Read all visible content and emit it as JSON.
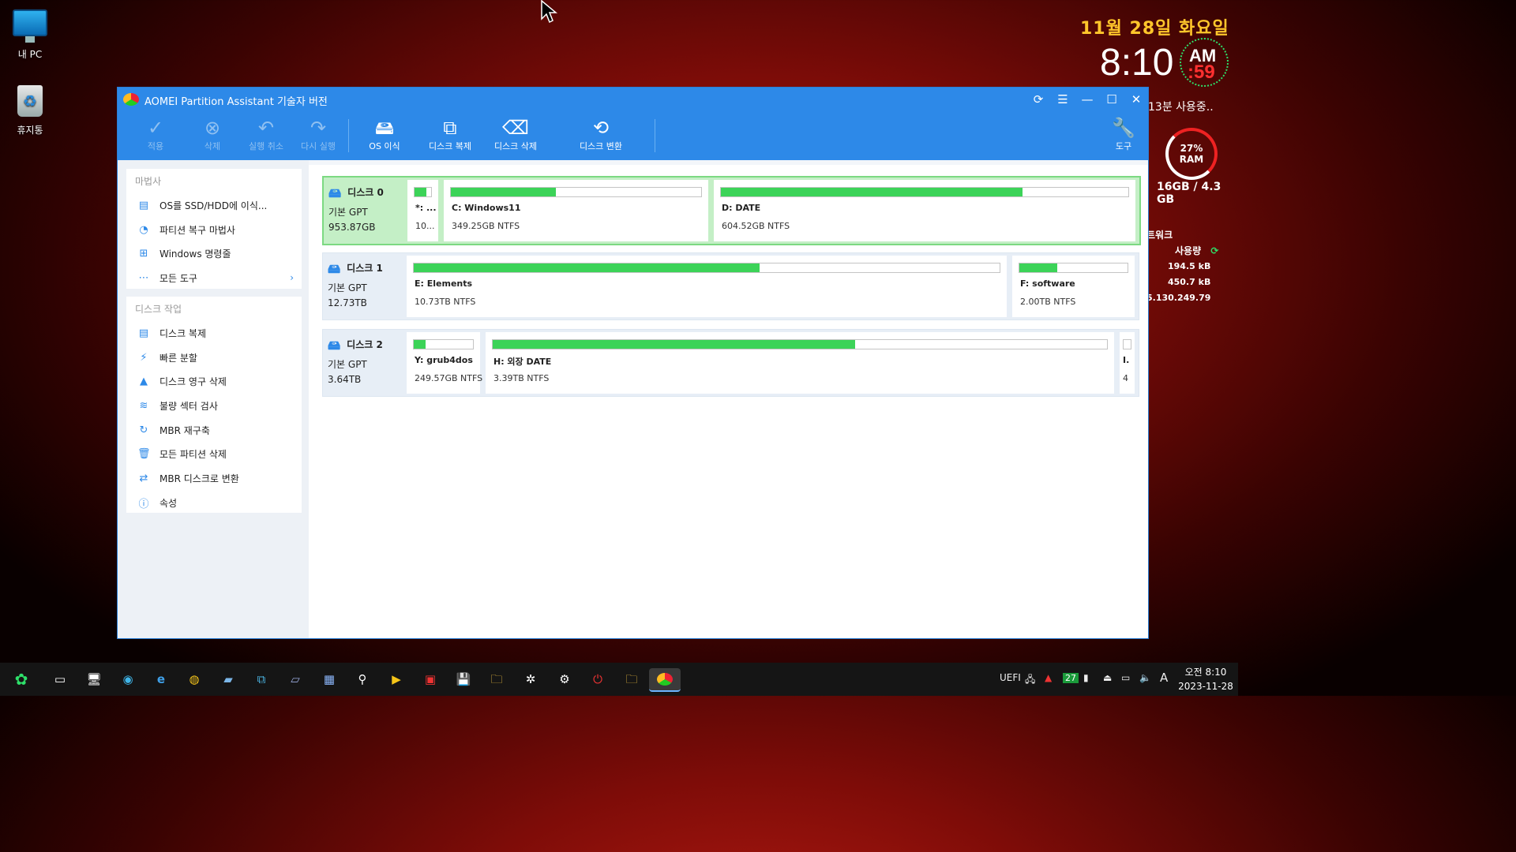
{
  "desktop": {
    "icons": [
      {
        "label": "내 PC",
        "icon": "monitor-icon"
      },
      {
        "label": "휴지통",
        "icon": "recycle-bin-icon"
      }
    ]
  },
  "widget": {
    "date": "11월 28일 화요일",
    "time": "8:10",
    "ampm": "AM",
    "seconds": ":59",
    "uptime": "13분 사용중..",
    "ram_percent": "27%",
    "ram_label": "RAM",
    "memory": "16GB / 4.3 GB",
    "network_title": "트워크",
    "network_usage_label": "사용량",
    "network_up": "194.5 kB",
    "network_down": "450.7 kB",
    "network_ip": "5.130.249.79"
  },
  "window": {
    "title": "AOMEI Partition Assistant 기술자 버전",
    "toolbar": {
      "apply": "적용",
      "discard": "삭제",
      "undo": "실행 취소",
      "redo": "다시 실행",
      "os_migrate": "OS 이식",
      "disk_clone": "디스크 복제",
      "disk_wipe": "디스크 삭제",
      "disk_convert": "디스크 변환",
      "tools": "도구"
    },
    "sidebar": {
      "wizard_header": "마법사",
      "wizard_items": [
        {
          "label": "OS를 SSD/HDD에 이식...",
          "icon": "migrate-icon"
        },
        {
          "label": "파티션 복구 마법사",
          "icon": "recovery-icon"
        },
        {
          "label": "Windows 명령줄",
          "icon": "windows-icon"
        },
        {
          "label": "모든 도구",
          "icon": "more-icon"
        }
      ],
      "disk_header": "디스크 작업",
      "disk_items": [
        {
          "label": "디스크 복제",
          "icon": "clone-icon"
        },
        {
          "label": "빠른 분할",
          "icon": "lightning-icon"
        },
        {
          "label": "디스크 영구 삭제",
          "icon": "wipe-icon"
        },
        {
          "label": "불량 섹터 검사",
          "icon": "sector-scan-icon"
        },
        {
          "label": "MBR 재구축",
          "icon": "rebuild-icon"
        },
        {
          "label": "모든 파티션 삭제",
          "icon": "trash-icon"
        },
        {
          "label": "MBR 디스크로 변환",
          "icon": "convert-icon"
        },
        {
          "label": "속성",
          "icon": "info-icon"
        }
      ]
    },
    "disks": [
      {
        "name": "디스크 0",
        "num": "0",
        "type": "기본 GPT",
        "size": "953.87GB",
        "partitions": [
          {
            "name": "*: ...",
            "info": "10...",
            "used": 0.7
          },
          {
            "name": "C: Windows11",
            "info": "349.25GB NTFS",
            "used": 0.42
          },
          {
            "name": "D: DATE",
            "info": "604.52GB NTFS",
            "used": 0.74
          }
        ]
      },
      {
        "name": "디스크 1",
        "num": "1",
        "type": "기본 GPT",
        "size": "12.73TB",
        "partitions": [
          {
            "name": "E: Elements",
            "info": "10.73TB NTFS",
            "used": 0.59
          },
          {
            "name": "F: software",
            "info": "2.00TB NTFS",
            "used": 0.35
          }
        ]
      },
      {
        "name": "디스크 2",
        "num": "2",
        "type": "기본 GPT",
        "size": "3.64TB",
        "partitions": [
          {
            "name": "Y: grub4dos",
            "info": "249.57GB NTFS",
            "used": 0.2
          },
          {
            "name": "H: 외장 DATE",
            "info": "3.39TB NTFS",
            "used": 0.59
          },
          {
            "name": "I.",
            "info": "4",
            "used": 0.0
          }
        ]
      }
    ]
  },
  "taskbar": {
    "tray_uefi": "UEFI",
    "tray_badge": "27",
    "tray_ime": "A",
    "clock_time": "오전 8:10",
    "clock_date": "2023-11-28"
  }
}
